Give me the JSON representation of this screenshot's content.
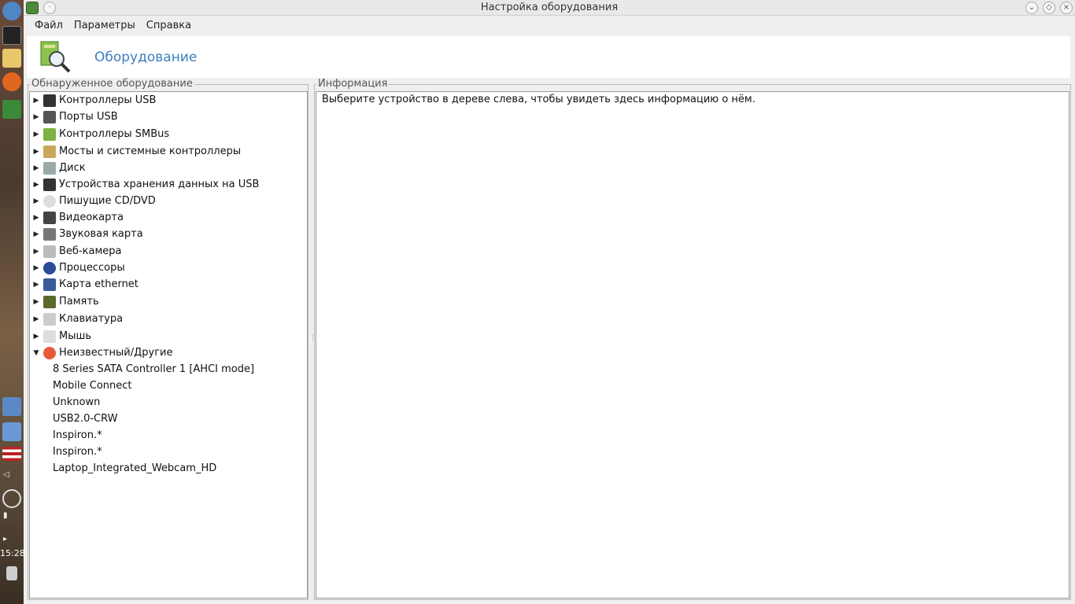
{
  "window": {
    "title": "Настройка оборудования"
  },
  "menu": {
    "file": "Файл",
    "params": "Параметры",
    "help": "Справка"
  },
  "header": {
    "title": "Оборудование"
  },
  "panels": {
    "left_label": "Обнаруженное оборудование",
    "right_label": "Информация"
  },
  "tree": {
    "items": [
      {
        "label": "Контроллеры USB",
        "icon": "usb-icon"
      },
      {
        "label": "Порты USB",
        "icon": "usb-port-icon"
      },
      {
        "label": "Контроллеры SMBus",
        "icon": "smbus-icon"
      },
      {
        "label": "Мосты и системные контроллеры",
        "icon": "bridge-icon"
      },
      {
        "label": "Диск",
        "icon": "disk-icon"
      },
      {
        "label": "Устройства хранения данных на USB",
        "icon": "usb-storage-icon"
      },
      {
        "label": "Пишущие CD/DVD",
        "icon": "cd-icon"
      },
      {
        "label": "Видеокарта",
        "icon": "video-card-icon"
      },
      {
        "label": "Звуковая карта",
        "icon": "speaker-icon"
      },
      {
        "label": "Веб-камера",
        "icon": "webcam-icon"
      },
      {
        "label": "Процессоры",
        "icon": "cpu-icon"
      },
      {
        "label": "Карта ethernet",
        "icon": "network-icon"
      },
      {
        "label": "Память",
        "icon": "memory-icon"
      },
      {
        "label": "Клавиатура",
        "icon": "keyboard-icon"
      },
      {
        "label": "Мышь",
        "icon": "mouse-icon"
      },
      {
        "label": "Неизвестный/Другие",
        "icon": "unknown-icon"
      }
    ],
    "children": [
      "8 Series SATA Controller 1 [AHCI mode]",
      "Mobile Connect",
      "Unknown",
      "USB2.0-CRW",
      "Inspiron.*",
      "Inspiron.*",
      "Laptop_Integrated_Webcam_HD"
    ]
  },
  "info": {
    "message": "Выберите устройство в дереве слева, чтобы увидеть здесь информацию о нём."
  },
  "dock": {
    "clock": "15:28"
  }
}
